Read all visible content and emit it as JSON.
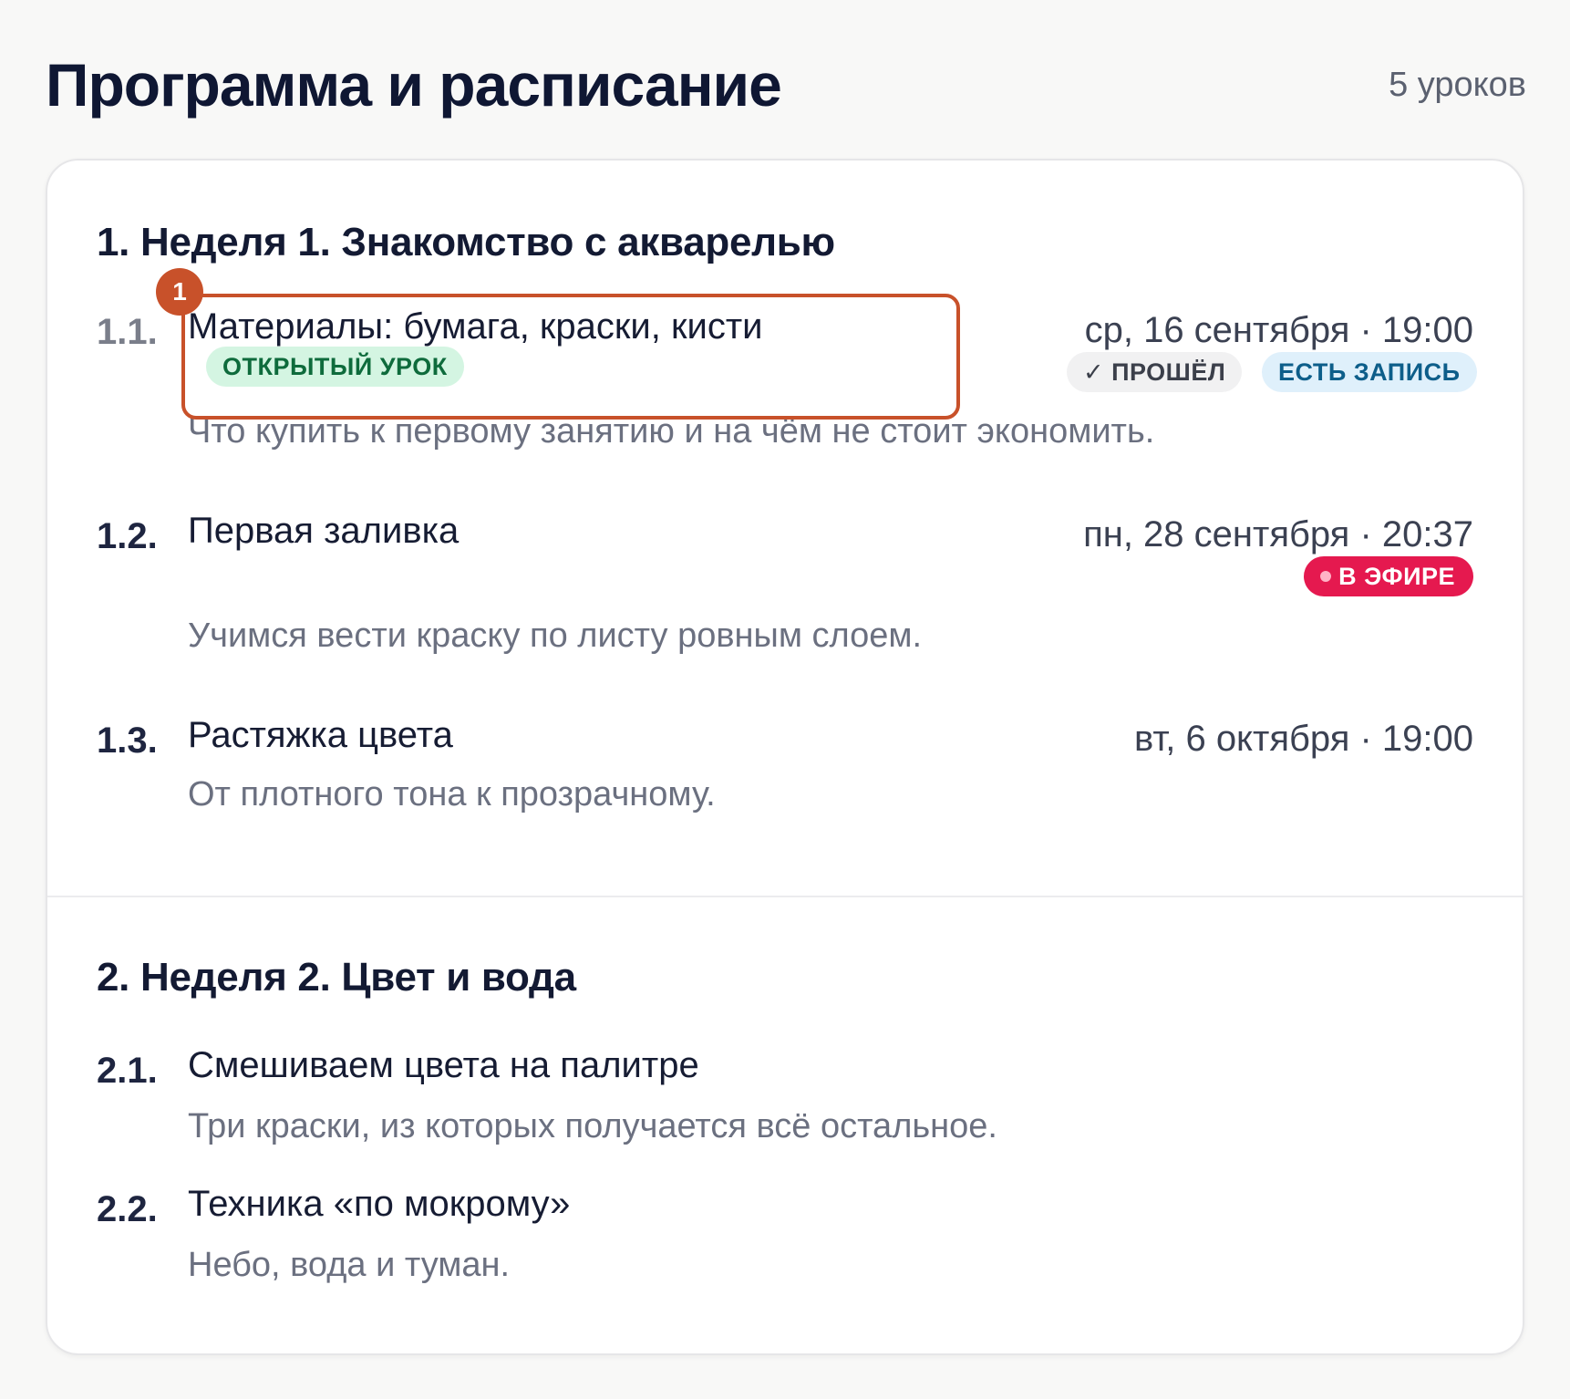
{
  "header": {
    "title": "Программа и расписание",
    "count": "5 уроков"
  },
  "marker": {
    "label": "1"
  },
  "modules": [
    {
      "title": "1. Неделя 1. Знакомство с акварелью",
      "lessons": [
        {
          "num": "1.1.",
          "title": "Материалы: бумага, краски, кисти",
          "date": "ср, 16 сентября · 19:00",
          "badge_open": "ОТКРЫТЫЙ УРОК",
          "badge_done": "ПРОШЁЛ",
          "badge_record": "ЕСТЬ ЗАПИСЬ",
          "desc": "Что купить к первому занятию и на чём не стоит экономить."
        },
        {
          "num": "1.2.",
          "title": "Первая заливка",
          "date": "пн, 28 сентября · 20:37",
          "badge_live": "В ЭФИРЕ",
          "desc": "Учимся вести краску по листу ровным слоем."
        },
        {
          "num": "1.3.",
          "title": "Растяжка цвета",
          "date": "вт, 6 октября · 19:00",
          "desc": "От плотного тона к прозрачному."
        }
      ]
    },
    {
      "title": "2. Неделя 2. Цвет и вода",
      "lessons": [
        {
          "num": "2.1.",
          "title": "Смешиваем цвета на палитре",
          "desc": "Три краски, из которых получается всё остальное."
        },
        {
          "num": "2.2.",
          "title": "Техника «по мокрому»",
          "desc": "Небо, вода и туман."
        }
      ]
    }
  ],
  "colors": {
    "accent": "#c8512a",
    "live": "#e5194f",
    "open": "#0e6b3c",
    "record": "#0d5e8a"
  }
}
